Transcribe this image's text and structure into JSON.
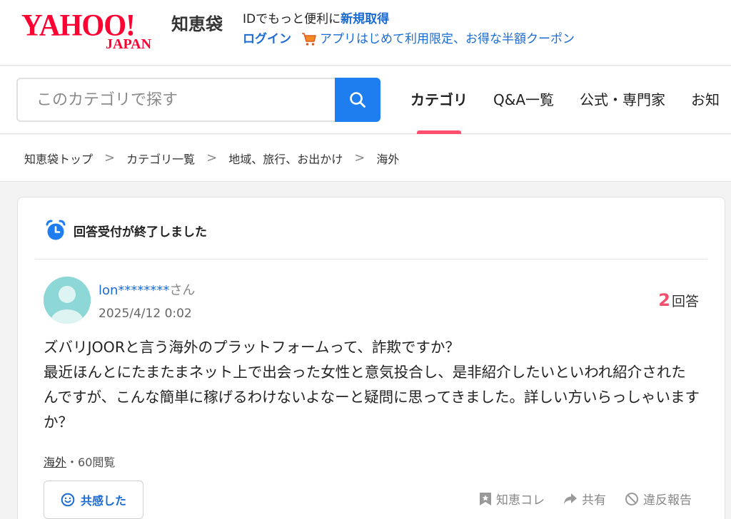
{
  "header": {
    "logo_main": "YAHOO!",
    "logo_sub": "JAPAN",
    "service_name": "知恵袋",
    "promo_prefix": "IDでもっと便利に",
    "promo_signup": "新規取得",
    "login_label": "ログイン",
    "coupon_text": "アプリはじめて利用限定、お得な半額クーポン",
    "cart_icon": "shopping-cart-icon"
  },
  "search": {
    "placeholder": "このカテゴリで探す",
    "button_icon": "search-icon"
  },
  "tabs": [
    {
      "label": "カテゴリ",
      "active": true
    },
    {
      "label": "Q&A一覧",
      "active": false
    },
    {
      "label": "公式・専門家",
      "active": false
    },
    {
      "label": "お知",
      "active": false
    }
  ],
  "breadcrumb": {
    "separator": ">",
    "items": [
      "知恵袋トップ",
      "カテゴリ一覧",
      "地域、旅行、お出かけ",
      "海外"
    ]
  },
  "question": {
    "status": "回答受付が終了しました",
    "username": "lon********",
    "honorific": "さん",
    "date": "2025/4/12 0:02",
    "answer_count": "2",
    "answer_label": "回答",
    "body_lines": [
      "ズバリJOORと言う海外のプラットフォームって、詐欺ですか？",
      "最近ほんとにたまたまネット上で出会った女性と意気投合し、是非紹介したいといわれ紹介されたんですが、こんな簡単に稼げるわけないよなーと疑問に思ってきました。詳しい方いらっしゃいますか？"
    ],
    "category": "海外",
    "views": "・60閲覧",
    "empathy_label": "共感した",
    "actions": {
      "bookmark": "知恵コレ",
      "share": "共有",
      "report": "違反報告"
    }
  },
  "colors": {
    "brand": "#ff0033",
    "link": "#1a6bd4",
    "search_button": "#1e7ef0",
    "tab_indicator": "#ff4d6d",
    "answer_count": "#f0506e",
    "avatar": "#8dd8d6"
  }
}
